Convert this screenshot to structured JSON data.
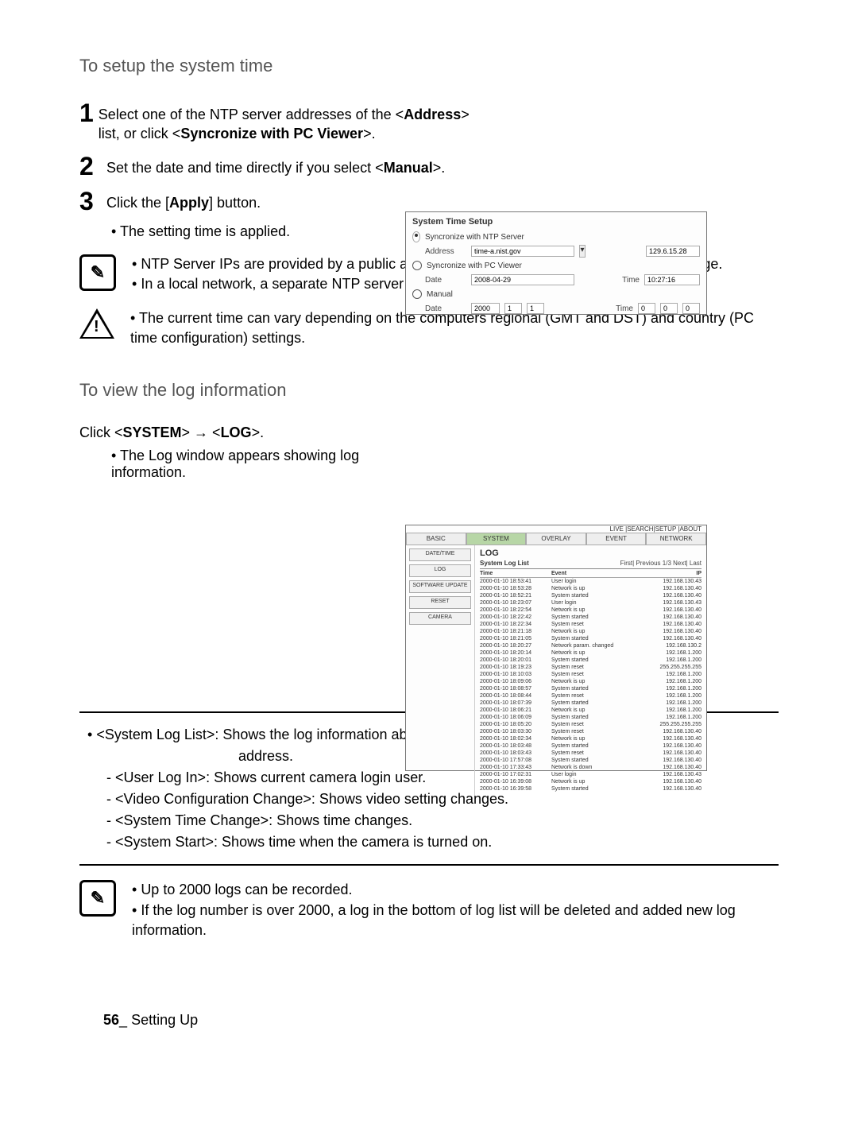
{
  "h_time": "To setup the system time",
  "steps": [
    "Select one of the NTP server addresses of the <Address> list, or click <Syncronize with PC Viewer>.",
    "Set the date and time directly if you select <Manual>.",
    "Click the [Apply] button."
  ],
  "step1_bold1": "Address",
  "step1_bold2": "Syncronize with PC Viewer",
  "step2_bold": "Manual",
  "step3_bold": "Apply",
  "sub_applied": "The setting time is applied.",
  "note1_a": "NTP Server IPs are provided by a public agency and their list is therefore subject to change.",
  "note1_b": "In a local network, a separate NTP server must be manually defined.",
  "warn_a": "The current time can vary depending on the computers regional (GMT and DST) and country (PC time configuration) settings.",
  "h_log": "To view the log information",
  "log_click_pre": "Click <",
  "log_click_sys": "SYSTEM",
  "log_click_mid": "> → <",
  "log_click_log": "LOG",
  "log_click_post": ">.",
  "log_sub": "The Log window appears showing log information.",
  "desc": {
    "b1a": "<System Log List>: Shows the log information about the system changes along with time and IP",
    "b1a2": "address.",
    "u1": "<User Log In>: Shows current camera login user.",
    "u2": "<Video Configuration Change>: Shows video setting changes.",
    "u3": "<System Time Change>: Shows time changes.",
    "u4": "<System Start>: Shows time when the camera is turned on."
  },
  "note2_a": "Up to 2000 logs can be recorded.",
  "note2_b": "If the log number is over 2000, a log in the bottom of log list will be deleted and added new log information.",
  "footer_page": "56",
  "footer_sep": "_",
  "footer_section": "Setting Up",
  "time_panel": {
    "title": "System Time Setup",
    "opt_ntp": "Syncronize with NTP Server",
    "lbl_addr": "Address",
    "addr_val": "time-a.nist.gov",
    "ip_val": "129.6.15.28",
    "opt_pc": "Syncronize with PC Viewer",
    "lbl_date": "Date",
    "date_val": "2008-04-29",
    "lbl_time": "Time",
    "time_val": "10:27:16",
    "opt_manual": "Manual",
    "y": "2000",
    "m": "1",
    "d": "1",
    "h": "0",
    "mi": "0",
    "s": "0"
  },
  "log_panel": {
    "topnav": "LIVE |SEARCH|SETUP |ABOUT",
    "tabs": [
      "BASIC",
      "SYSTEM",
      "OVERLAY",
      "EVENT",
      "NETWORK"
    ],
    "side": [
      "DATE/TIME",
      "LOG",
      "SOFTWARE UPDATE",
      "RESET",
      "CAMERA"
    ],
    "h": "LOG",
    "h2": "System Log List",
    "pager": "First| Previous   1/3   Next| Last",
    "col_time": "Time",
    "col_event": "Event",
    "col_ip": "IP",
    "rows": [
      [
        "2000-01-10 18:53:41",
        "User login",
        "192.168.130.43"
      ],
      [
        "2000-01-10 18:53:28",
        "Network is up",
        "192.168.130.40"
      ],
      [
        "2000-01-10 18:52:21",
        "System started",
        "192.168.130.40"
      ],
      [
        "2000-01-10 18:23:07",
        "User login",
        "192.168.130.43"
      ],
      [
        "2000-01-10 18:22:54",
        "Network is up",
        "192.168.130.40"
      ],
      [
        "2000-01-10 18:22:42",
        "System started",
        "192.168.130.40"
      ],
      [
        "2000-01-10 18:22:34",
        "System reset",
        "192.168.130.40"
      ],
      [
        "2000-01-10 18:21:18",
        "Network is up",
        "192.168.130.40"
      ],
      [
        "2000-01-10 18:21:05",
        "System started",
        "192.168.130.40"
      ],
      [
        "2000-01-10 18:20:27",
        "Network param. changed",
        "192.168.130.2"
      ],
      [
        "2000-01-10 18:20:14",
        "Network is up",
        "192.168.1.200"
      ],
      [
        "2000-01-10 18:20:01",
        "System started",
        "192.168.1.200"
      ],
      [
        "2000-01-10 18:19:23",
        "System reset",
        "255.255.255.255"
      ],
      [
        "2000-01-10 18:10:03",
        "System reset",
        "192.168.1.200"
      ],
      [
        "2000-01-10 18:09:06",
        "Network is up",
        "192.168.1.200"
      ],
      [
        "2000-01-10 18:08:57",
        "System started",
        "192.168.1.200"
      ],
      [
        "2000-01-10 18:08:44",
        "System reset",
        "192.168.1.200"
      ],
      [
        "2000-01-10 18:07:39",
        "System started",
        "192.168.1.200"
      ],
      [
        "2000-01-10 18:06:21",
        "Network is up",
        "192.168.1.200"
      ],
      [
        "2000-01-10 18:06:09",
        "System started",
        "192.168.1.200"
      ],
      [
        "2000-01-10 18:05:20",
        "System reset",
        "255.255.255.255"
      ],
      [
        "2000-01-10 18:03:30",
        "System reset",
        "192.168.130.40"
      ],
      [
        "2000-01-10 18:02:34",
        "Network is up",
        "192.168.130.40"
      ],
      [
        "2000-01-10 18:03:48",
        "System started",
        "192.168.130.40"
      ],
      [
        "2000-01-10 18:03:43",
        "System reset",
        "192.168.130.40"
      ],
      [
        "2000-01-10 17:57:08",
        "System started",
        "192.168.130.40"
      ],
      [
        "2000-01-10 17:33:43",
        "Network is down",
        "192.168.130.40"
      ],
      [
        "2000-01-10 17:02:31",
        "User login",
        "192.168.130.43"
      ],
      [
        "2000-01-10 16:39:08",
        "Network is up",
        "192.168.130.40"
      ],
      [
        "2000-01-10 16:39:58",
        "System started",
        "192.168.130.40"
      ]
    ]
  }
}
